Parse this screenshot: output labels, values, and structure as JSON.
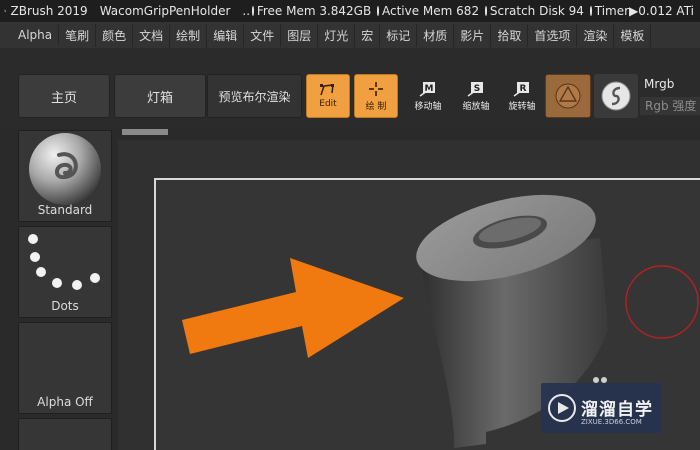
{
  "titlebar": {
    "app": "ZBrush 2019",
    "document": "WacomGripPenHolder",
    "ellipsis": "..",
    "free_mem": "Free Mem 3.842GB",
    "active_mem": "Active Mem 682",
    "scratch_disk": "Scratch Disk 94",
    "timer": "Timer▶0.012 ATi"
  },
  "menubar": {
    "items": [
      "Alpha",
      "笔刷",
      "颜色",
      "文档",
      "绘制",
      "编辑",
      "文件",
      "图层",
      "灯光",
      "宏",
      "标记",
      "材质",
      "影片",
      "拾取",
      "首选项",
      "渲染",
      "模板"
    ]
  },
  "shelf": {
    "home": "主页",
    "lightbox": "灯箱",
    "bpr": "预览布尔渲染",
    "edit": "Edit",
    "draw": "绘 制",
    "move": "移动轴",
    "scale": "缩放轴",
    "rotate": "旋转轴",
    "move_key": "M",
    "scale_key": "S",
    "rotate_key": "R",
    "mrgb": "Mrgb",
    "rgb_intensity": "Rgb 强度"
  },
  "tray": {
    "brush_label": "Standard",
    "stroke_label": "Dots",
    "alpha_label": "Alpha Off"
  },
  "watermark": {
    "title": "溜溜自学",
    "subtitle": "ZIXUE.3D66.COM"
  },
  "colors": {
    "accent": "#f0a040",
    "arrow": "#f07a10",
    "background": "#2a2a2a"
  }
}
